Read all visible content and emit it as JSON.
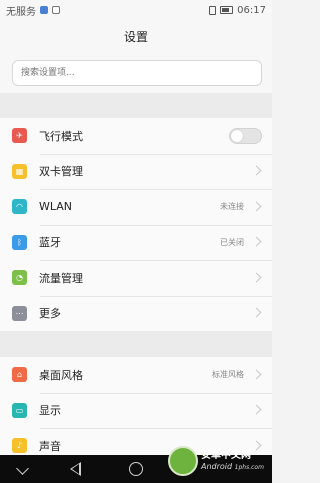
{
  "status_bar": {
    "carrier": "无服务",
    "time": "06:17"
  },
  "title": "设置",
  "search": {
    "placeholder": "搜索设置项..."
  },
  "group1": [
    {
      "icon": "airplane-icon",
      "color": "#e85a4f",
      "label": "飞行模式",
      "control": "toggle",
      "toggle_on": false
    },
    {
      "icon": "sim-card-icon",
      "color": "#f5c02a",
      "label": "双卡管理",
      "control": "chevron"
    },
    {
      "icon": "wifi-icon",
      "color": "#2fb7c9",
      "label": "WLAN",
      "value": "未连接",
      "control": "chevron"
    },
    {
      "icon": "bluetooth-icon",
      "color": "#3a9be8",
      "label": "蓝牙",
      "value": "已关闭",
      "control": "chevron"
    },
    {
      "icon": "data-usage-icon",
      "color": "#7cc04a",
      "label": "流量管理",
      "control": "chevron"
    },
    {
      "icon": "more-icon",
      "color": "#8a8f99",
      "label": "更多",
      "control": "chevron"
    }
  ],
  "group2": [
    {
      "icon": "home-theme-icon",
      "color": "#ef6a45",
      "label": "桌面风格",
      "value": "标准风格",
      "control": "chevron"
    },
    {
      "icon": "display-icon",
      "color": "#28b7b0",
      "label": "显示",
      "control": "chevron"
    },
    {
      "icon": "sound-icon",
      "color": "#f5c02a",
      "label": "声音",
      "control": "chevron"
    }
  ],
  "watermark": {
    "text_cn": "安卓中文网",
    "text_en": "Android",
    "text_small": "1phs.com"
  }
}
